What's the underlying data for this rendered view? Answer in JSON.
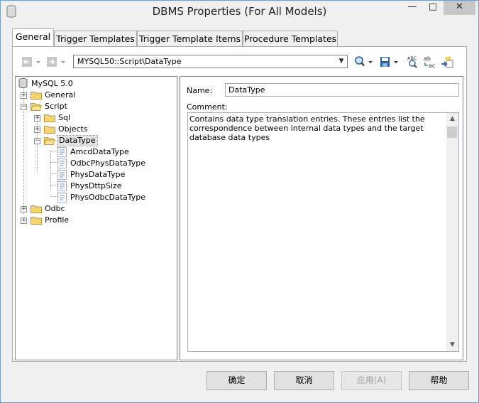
{
  "window": {
    "title": "DBMS Properties (For All Models)",
    "controls": {
      "minimize": "—",
      "maximize": "□",
      "close": "✕"
    }
  },
  "tabs": [
    {
      "label": "General",
      "active": true
    },
    {
      "label": "Trigger Templates",
      "active": false
    },
    {
      "label": "Trigger Template Items",
      "active": false
    },
    {
      "label": "Procedure Templates",
      "active": false
    }
  ],
  "toolbar": {
    "path": "MYSQL50::Script\\DataType",
    "icons": [
      "back-arrow-icon",
      "forward-arrow-icon",
      "find-icon",
      "save-icon",
      "spell-check-icon",
      "replace-icon",
      "import-icon"
    ]
  },
  "tree": {
    "root": "MySQL 5.0",
    "items": [
      {
        "label": "General",
        "level": 1,
        "expanded": false
      },
      {
        "label": "Script",
        "level": 1,
        "expanded": true
      },
      {
        "label": "Sql",
        "level": 2,
        "expanded": false
      },
      {
        "label": "Objects",
        "level": 2,
        "expanded": false
      },
      {
        "label": "DataType",
        "level": 2,
        "expanded": true,
        "selected": true
      },
      {
        "label": "AmcdDataType",
        "level": 3
      },
      {
        "label": "OdbcPhysDataType",
        "level": 3
      },
      {
        "label": "PhysDataType",
        "level": 3
      },
      {
        "label": "PhysDttpSize",
        "level": 3
      },
      {
        "label": "PhysOdbcDataType",
        "level": 3
      },
      {
        "label": "Odbc",
        "level": 1,
        "expanded": false
      },
      {
        "label": "Profile",
        "level": 1,
        "expanded": false
      }
    ]
  },
  "details": {
    "name_label": "Name:",
    "name_value": "DataType",
    "comment_label": "Comment:",
    "comment_value": "Contains data type translation entries. These entries list the correspondence between internal data types and the target database data types"
  },
  "buttons": {
    "ok": "确定",
    "cancel": "取消",
    "apply": "应用(A)",
    "help": "帮助"
  }
}
